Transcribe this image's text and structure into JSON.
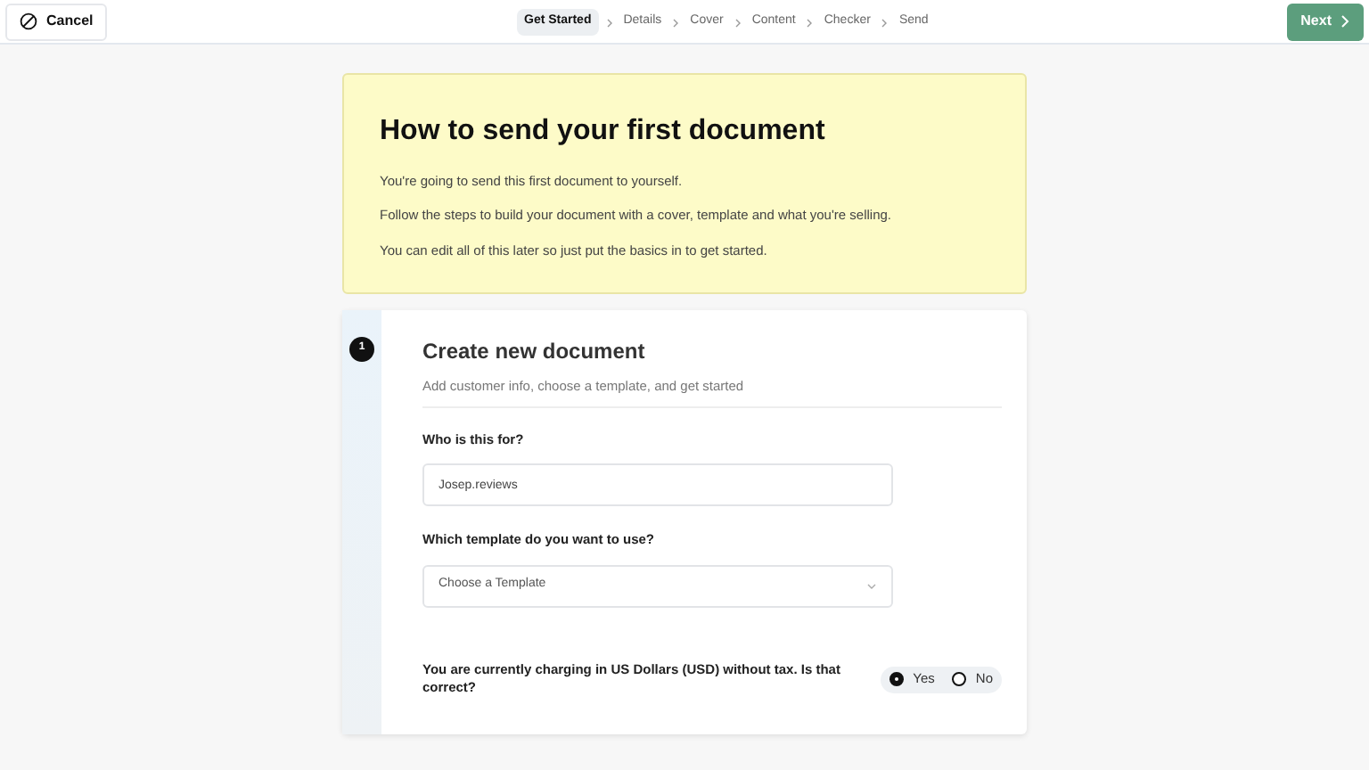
{
  "header": {
    "cancel": "Cancel",
    "steps": [
      {
        "label": "Get Started",
        "selected": true
      },
      {
        "label": "Details",
        "selected": false
      },
      {
        "label": "Cover",
        "selected": false
      },
      {
        "label": "Content",
        "selected": false
      },
      {
        "label": "Checker",
        "selected": false
      },
      {
        "label": "Send",
        "selected": false
      }
    ],
    "next": "Next"
  },
  "intro": {
    "title": "How to send your first document",
    "paragraphs": [
      "You're going to send this first document to yourself.",
      "Follow the steps to build your document with a cover, template and what you're selling.",
      "You can edit all of this later so just put the basics in to get started."
    ]
  },
  "step": {
    "number": "1",
    "title": "Create new document",
    "subtitle": "Add customer info, choose a template, and get started",
    "fields": [
      {
        "kind": "text",
        "label": "Who is this for?",
        "value": "Josep.reviews"
      },
      {
        "kind": "select",
        "label": "Which template do you want to use?",
        "placeholder": "Choose a Template"
      }
    ],
    "question": {
      "text": "You are currently charging in US Dollars (USD) without tax. Is that correct?",
      "options": [
        {
          "label": "Yes",
          "selected": true
        },
        {
          "label": "No",
          "selected": false
        }
      ]
    }
  }
}
